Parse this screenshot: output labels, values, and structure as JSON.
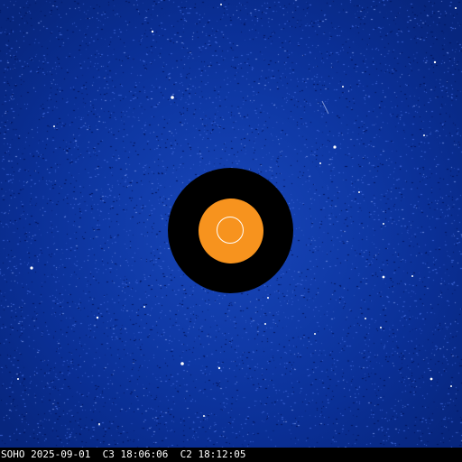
{
  "image": {
    "caption": "SOHO 2025-09-01  C3 18:06:06  C2 18:12:05",
    "colors": {
      "background": "#0f39a6",
      "occulter": "#000000",
      "sun_disk": "#f7931e",
      "sun_limb": "#ffffff",
      "caption_bar": "#000000",
      "caption_text": "#ffffff"
    }
  }
}
